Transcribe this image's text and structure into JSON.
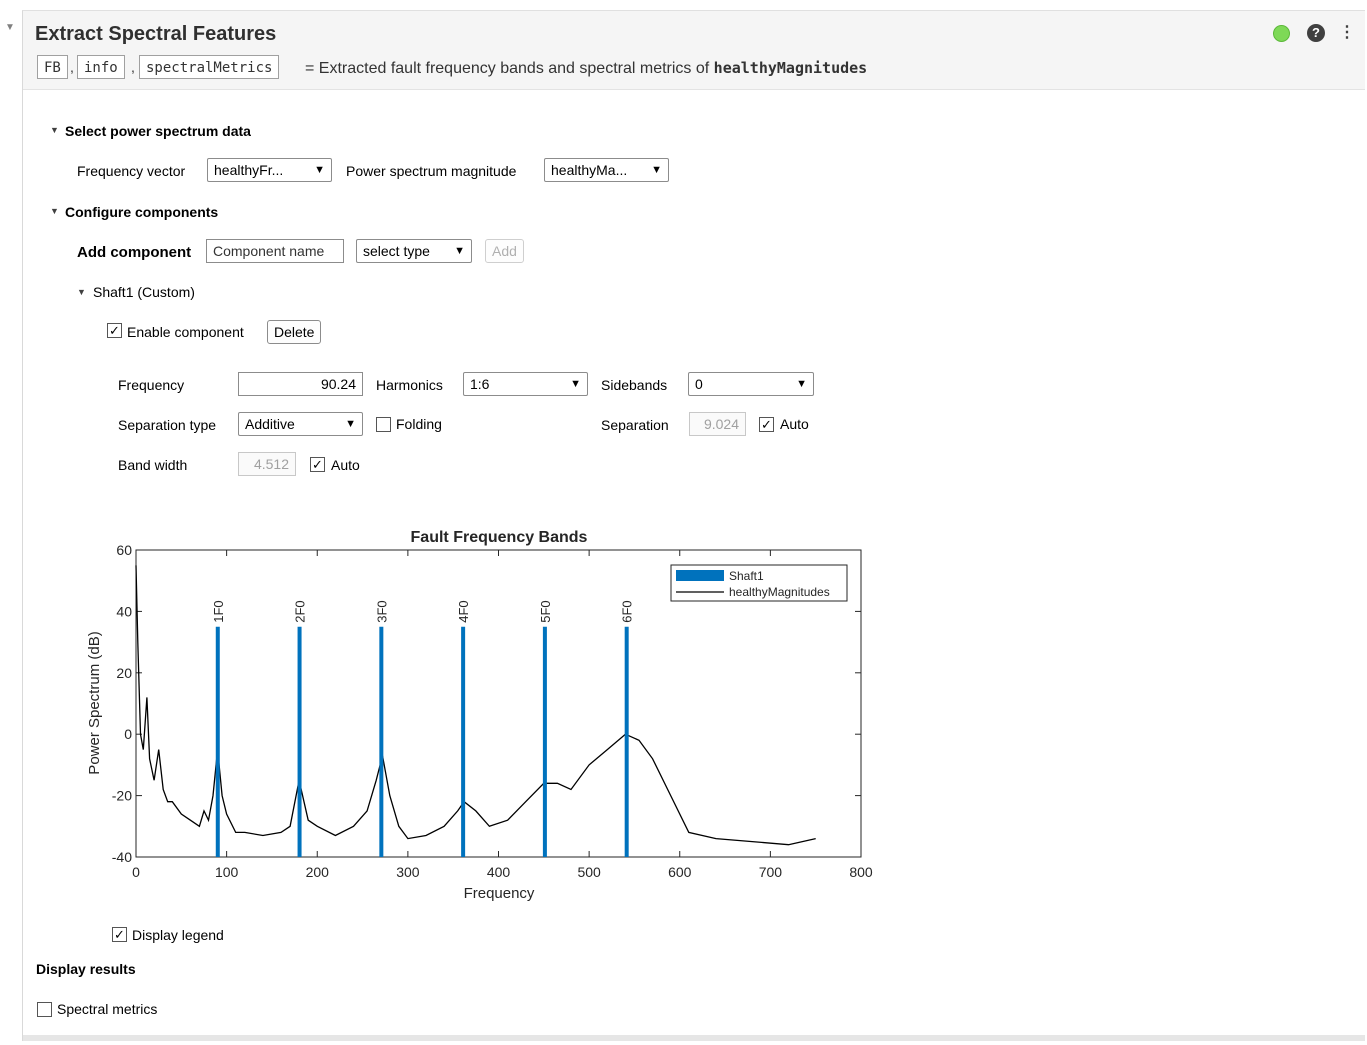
{
  "task": {
    "title": "Extract Spectral Features",
    "outputs": [
      "FB",
      "info",
      "spectralMetrics"
    ],
    "description_prefix": "= Extracted fault frequency bands and spectral metrics of",
    "description_var": "healthyMagnitudes"
  },
  "sections": {
    "select_data": {
      "title": "Select power spectrum data",
      "frequency_label": "Frequency vector",
      "frequency_value": "healthyFr...",
      "magnitude_label": "Power spectrum magnitude",
      "magnitude_value": "healthyMa..."
    },
    "configure": {
      "title": "Configure components",
      "add_label": "Add component",
      "name_placeholder": "Component name",
      "type_value": "select type",
      "add_button": "Add"
    },
    "component": {
      "title": "Shaft1 (Custom)",
      "enable_label": "Enable component",
      "delete_button": "Delete",
      "frequency_label": "Frequency",
      "frequency_value": "90.24",
      "harmonics_label": "Harmonics",
      "harmonics_value": "1:6",
      "sidebands_label": "Sidebands",
      "sidebands_value": "0",
      "sep_type_label": "Separation type",
      "sep_type_value": "Additive",
      "folding_label": "Folding",
      "separation_label": "Separation",
      "separation_value": "9.024",
      "auto_label": "Auto",
      "bandwidth_label": "Band width",
      "bandwidth_value": "4.512",
      "auto_label2": "Auto"
    },
    "display": {
      "legend_label": "Display legend",
      "results_title": "Display results",
      "metrics_label": "Spectral metrics"
    }
  },
  "icons": {
    "status": "status-ok-icon",
    "help": "help-icon",
    "more": "more-options-icon"
  },
  "chart_data": {
    "type": "line",
    "title": "Fault Frequency Bands",
    "xlabel": "Frequency",
    "ylabel": "Power Spectrum (dB)",
    "xlim": [
      0,
      800
    ],
    "ylim": [
      -40,
      60
    ],
    "xticks": [
      0,
      100,
      200,
      300,
      400,
      500,
      600,
      700,
      800
    ],
    "yticks": [
      -40,
      -20,
      0,
      20,
      40,
      60
    ],
    "legend_placement": "top-right",
    "bands": {
      "name": "Shaft1",
      "color": "#0072bd",
      "labels": [
        "1F0",
        "2F0",
        "3F0",
        "4F0",
        "5F0",
        "6F0"
      ],
      "x": [
        90.24,
        180.48,
        270.72,
        360.96,
        451.2,
        541.44
      ],
      "y_top": 35
    },
    "series": [
      {
        "name": "healthyMagnitudes",
        "color": "#000000",
        "x": [
          0,
          2,
          5,
          8,
          12,
          15,
          20,
          25,
          30,
          35,
          40,
          50,
          60,
          70,
          75,
          80,
          85,
          90,
          95,
          100,
          110,
          120,
          140,
          160,
          170,
          180,
          190,
          200,
          220,
          240,
          255,
          265,
          272,
          280,
          290,
          300,
          320,
          340,
          355,
          362,
          375,
          390,
          410,
          430,
          450,
          465,
          480,
          500,
          520,
          540,
          555,
          570,
          590,
          610,
          640,
          680,
          720,
          750
        ],
        "y": [
          55,
          30,
          0,
          -5,
          12,
          -8,
          -15,
          -5,
          -18,
          -22,
          -22,
          -26,
          -28,
          -30,
          -25,
          -28,
          -20,
          -5,
          -20,
          -26,
          -32,
          -32,
          -33,
          -32,
          -30,
          -15,
          -28,
          -30,
          -33,
          -30,
          -25,
          -15,
          -7,
          -20,
          -30,
          -34,
          -33,
          -30,
          -25,
          -22,
          -25,
          -30,
          -28,
          -22,
          -16,
          -16,
          -18,
          -10,
          -5,
          0,
          -2,
          -8,
          -20,
          -32,
          -34,
          -35,
          -36,
          -34
        ]
      }
    ]
  }
}
